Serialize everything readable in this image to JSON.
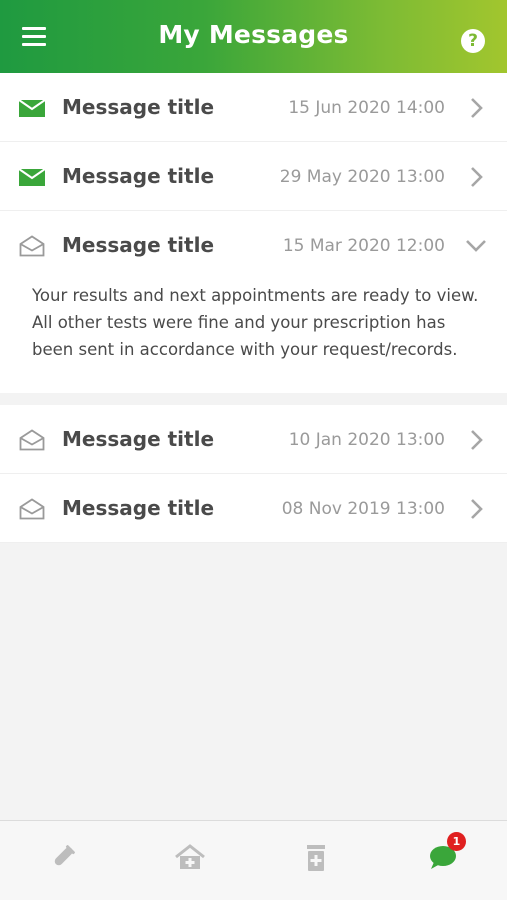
{
  "header": {
    "title": "My Messages"
  },
  "messages": [
    {
      "title": "Message title",
      "date": "15 Jun 2020 14:00",
      "read": false,
      "expanded": false
    },
    {
      "title": "Message title",
      "date": "29 May 2020 13:00",
      "read": false,
      "expanded": false
    },
    {
      "title": "Message title",
      "date": "15 Mar 2020 12:00",
      "read": true,
      "expanded": true,
      "body": "Your results and next appointments are ready to view. All other tests were fine and your prescription has been sent in accordance with your request/records."
    },
    {
      "title": "Message title",
      "date": "10 Jan 2020 13:00",
      "read": true,
      "expanded": false
    },
    {
      "title": "Message title",
      "date": "08 Nov 2019 13:00",
      "read": true,
      "expanded": false
    }
  ],
  "tabbar": {
    "tabs": [
      {
        "icon": "test-tube-icon"
      },
      {
        "icon": "home-plus-icon"
      },
      {
        "icon": "medicine-bottle-icon"
      },
      {
        "icon": "chat-bubble-icon",
        "active": true
      }
    ],
    "badge_count": "1"
  },
  "colors": {
    "accent": "#3aa63a",
    "accent_end": "#a2c62e",
    "badge": "#e02020"
  }
}
